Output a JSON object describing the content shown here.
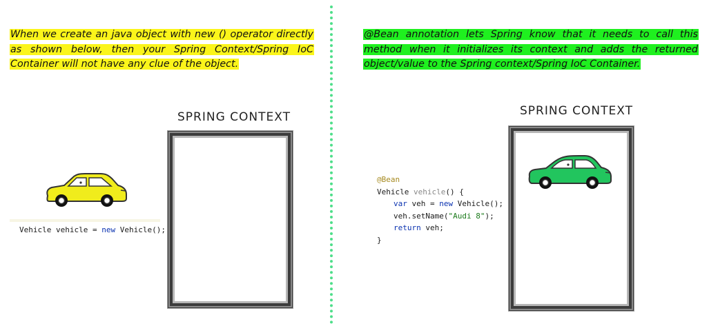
{
  "left": {
    "description": "When we create an java object with new () operator directly as shown below, then your Spring Context/Spring IoC Container will not have any clue of the object.",
    "context_title": "SPRING CONTEXT",
    "code": {
      "type": "Vehicle",
      "var": "vehicle",
      "assign": "=",
      "kw_new": "new",
      "ctor": "Vehicle();"
    },
    "car_color": "#f0ec1c"
  },
  "right": {
    "description": "@Bean annotation lets Spring know that it needs to call this method when it initializes its context and adds the returned object/value to the Spring context/Spring IoC Container.",
    "context_title": "SPRING CONTEXT",
    "code": {
      "annotation": "@Bean",
      "ret_type": "Vehicle",
      "method": "vehicle",
      "sig_tail": "() {",
      "kw_var": "var",
      "line2_mid": "veh =",
      "kw_new": "new",
      "line2_tail": "Vehicle();",
      "line3_head": "veh.setName(",
      "line3_str": "\"Audi 8\"",
      "line3_tail": ");",
      "kw_return": "return",
      "line4_tail": "veh;",
      "close": "}"
    },
    "car_color": "#22c55e"
  },
  "divider_color": "#4ede8a"
}
